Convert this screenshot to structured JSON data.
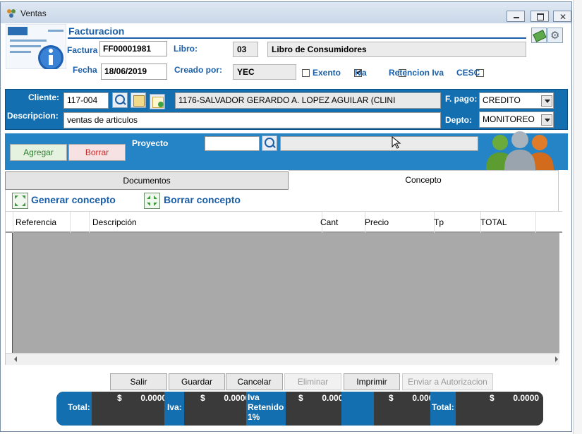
{
  "window": {
    "title": "Ventas"
  },
  "header": {
    "section_title": "Facturacion"
  },
  "form": {
    "factura_label": "Factura",
    "factura_value": "FF00001981",
    "libro_label": "Libro:",
    "libro_code": "03",
    "libro_name": "Libro de Consumidores",
    "fecha_label": "Fecha",
    "fecha_value": "18/06/2019",
    "creado_label": "Creado por:",
    "creado_value": "YEC",
    "exento_label": "Exento",
    "iva_label": "Iva",
    "iva_checked": true,
    "retencion_label": "Retencion Iva",
    "cesc_label": "CESC"
  },
  "client": {
    "cliente_label": "Cliente:",
    "cliente_code": "117-004",
    "cliente_name": "1176-SALVADOR GERARDO A. LOPEZ AGUILAR (CLINI",
    "fpago_label": "F. pago:",
    "fpago_value": "CREDITO",
    "descripcion_label": "Descripcion:",
    "descripcion_value": "ventas de articulos",
    "depto_label": "Depto:",
    "depto_value": "MONITOREO"
  },
  "actions": {
    "agregar": "Agregar",
    "borrar": "Borrar",
    "proyecto_label": "Proyecto",
    "proyecto_value": "",
    "proyecto_name": ""
  },
  "tabs": [
    {
      "label": "Documentos",
      "active": false
    },
    {
      "label": "Concepto",
      "active": true
    }
  ],
  "concepto": {
    "generar": "Generar concepto",
    "borrar": "Borrar concepto"
  },
  "grid": {
    "columns": [
      "Referencia",
      "Descripción",
      "Cant",
      "Precio",
      "Tp",
      "TOTAL"
    ]
  },
  "footer_buttons": {
    "salir": "Salir",
    "guardar": "Guardar",
    "cancelar": "Cancelar",
    "eliminar": "Eliminar",
    "imprimir": "Imprimir",
    "enviar": "Enviar a Autorizacion"
  },
  "totals": {
    "total_label": "Total:",
    "total_value": "$        0.0000",
    "iva_label": "Iva:",
    "iva_value": "$        0.0000",
    "iva_ret_label": "Iva Retenido 1%",
    "iva_ret_value": "$        0.0000",
    "extra_value": "$        0.0000",
    "total2_label": "Total:",
    "total2_value": "$        0.0000"
  },
  "colors": {
    "accent": "#136fb0",
    "title": "#1a5fa8",
    "grid_body": "#a9a9a9",
    "agregar_text": "#2e7d32",
    "borrar_text": "#c62828"
  }
}
